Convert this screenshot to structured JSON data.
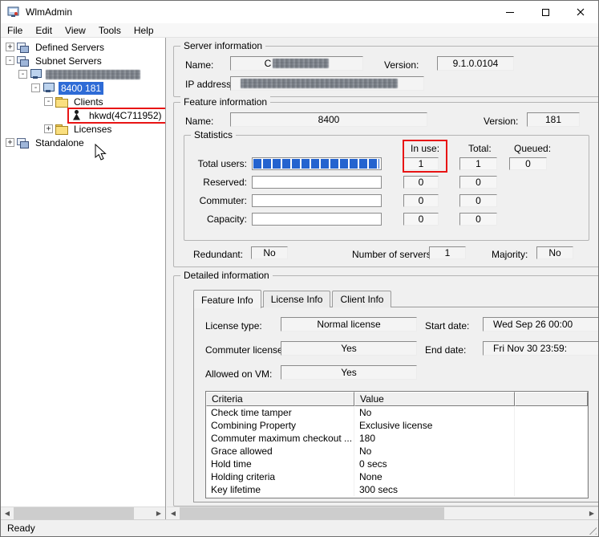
{
  "window": {
    "title": "WlmAdmin",
    "status": "Ready"
  },
  "menu": {
    "items": [
      "File",
      "Edit",
      "View",
      "Tools",
      "Help"
    ]
  },
  "tree": {
    "items": [
      {
        "label": "Defined Servers",
        "expand": "+"
      },
      {
        "label": "Subnet Servers",
        "expand": "-"
      },
      {
        "label": "",
        "expand": "-"
      },
      {
        "label": "8400 181",
        "expand": "-"
      },
      {
        "label": "Clients",
        "expand": "-"
      },
      {
        "label": "hkwd(4C711952)",
        "expand": ""
      },
      {
        "label": "Licenses",
        "expand": "+"
      },
      {
        "label": "Standalone",
        "expand": "+"
      }
    ]
  },
  "server_info": {
    "title": "Server information",
    "name_label": "Name:",
    "name_prefix": "C",
    "version_label": "Version:",
    "version_value": "9.1.0.0104",
    "ip_label": "IP address:"
  },
  "feature_info": {
    "title": "Feature information",
    "name_label": "Name:",
    "name_value": "8400",
    "version_label": "Version:",
    "version_value": "181"
  },
  "statistics": {
    "title": "Statistics",
    "headers": {
      "in_use": "In use:",
      "total": "Total:",
      "queued": "Queued:"
    },
    "rows": [
      {
        "label": "Total users:",
        "in_use": "1",
        "total": "1",
        "queued": "0"
      },
      {
        "label": "Reserved:",
        "in_use": "0",
        "total": "0"
      },
      {
        "label": "Commuter:",
        "in_use": "0",
        "total": "0"
      },
      {
        "label": "Capacity:",
        "in_use": "0",
        "total": "0"
      }
    ],
    "redundant_label": "Redundant:",
    "redundant_value": "No",
    "servers_label": "Number of servers:",
    "servers_value": "1",
    "majority_label": "Majority:",
    "majority_value": "No"
  },
  "detailed": {
    "title": "Detailed information",
    "tabs": [
      "Feature Info",
      "License Info",
      "Client Info"
    ],
    "fields": {
      "license_type_label": "License type:",
      "license_type_value": "Normal license",
      "start_date_label": "Start date:",
      "start_date_value": "Wed Sep 26 00:00",
      "commuter_label": "Commuter license:",
      "commuter_value": "Yes",
      "end_date_label": "End date:",
      "end_date_value": "Fri Nov 30 23:59:",
      "vm_label": "Allowed on VM:",
      "vm_value": "Yes"
    },
    "table": {
      "headers": [
        "Criteria",
        "Value"
      ],
      "rows": [
        {
          "criteria": "Check time tamper",
          "value": "No"
        },
        {
          "criteria": "Combining Property",
          "value": "Exclusive license"
        },
        {
          "criteria": "Commuter maximum checkout ...",
          "value": "180"
        },
        {
          "criteria": "Grace allowed",
          "value": "No"
        },
        {
          "criteria": "Hold time",
          "value": "0 secs"
        },
        {
          "criteria": "Holding criteria",
          "value": "None"
        },
        {
          "criteria": "Key lifetime",
          "value": "300 secs"
        }
      ]
    }
  },
  "colors": {
    "selection": "#2e6bd6",
    "progress": "#2463cf",
    "highlight": "#e81414"
  }
}
